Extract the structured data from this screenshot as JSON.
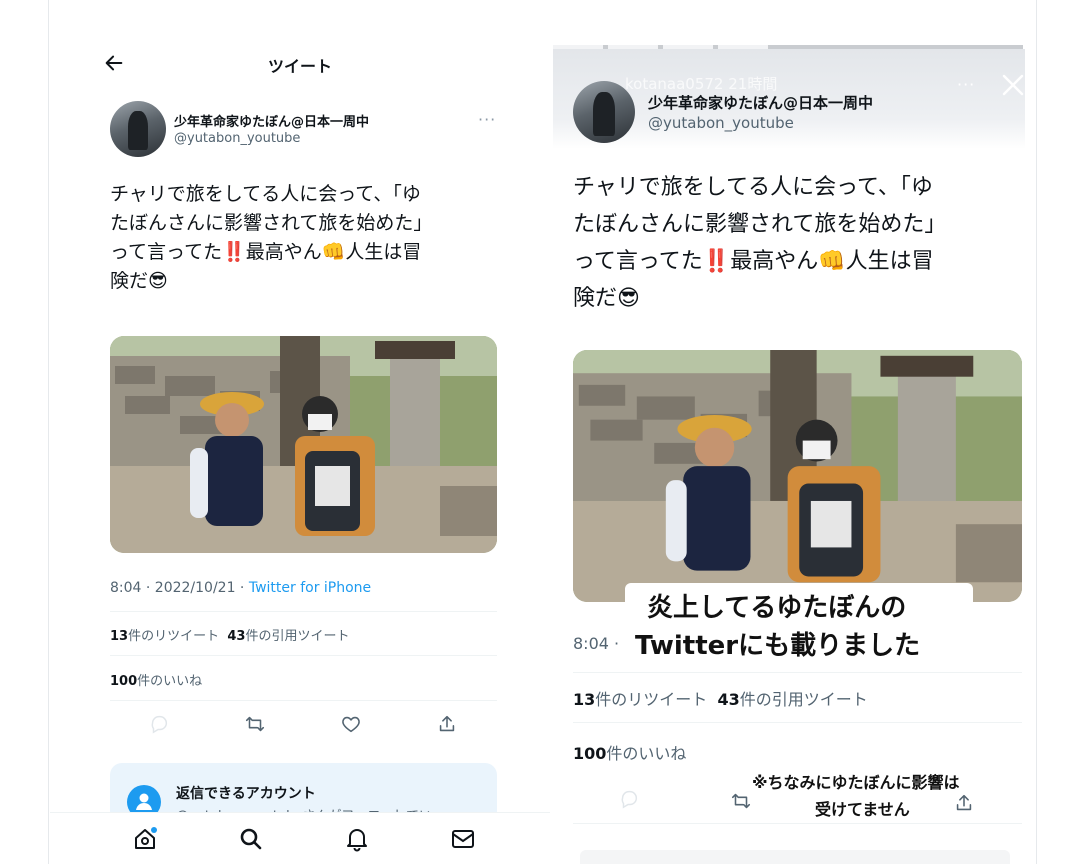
{
  "left": {
    "header": {
      "title": "ツイート"
    },
    "tweet": {
      "author_name": "少年革命家ゆたぼん@日本一周中",
      "author_handle": "@yutabon_youtube",
      "text_lines": [
        "チャリで旅をしてる人に会って、「ゆ",
        "たぼんさんに影響されて旅を始めた」",
        "って言ってた‼️最高やん👊人生は冒",
        "険だ😎"
      ],
      "timestamp": "8:04 · 2022/10/21 · ",
      "source": "Twitter for iPhone",
      "retweets_count": "13",
      "retweets_label": "件のリツイート",
      "quotes_count": "43",
      "quotes_label": "件の引用ツイート",
      "likes_count": "100",
      "likes_label": "件のいいね"
    },
    "reply_box": {
      "title": "返信できるアカウント",
      "subtitle": "@yutabon_youtubeさんがフォローしてい"
    },
    "nav": [
      "home-icon",
      "search-icon",
      "notifications-icon",
      "messages-icon"
    ],
    "actions": [
      "reply-icon",
      "retweet-icon",
      "like-icon",
      "share-icon"
    ]
  },
  "right": {
    "story_header": {
      "username": "kotanaa0572",
      "time": "21時間"
    },
    "tweet": {
      "author_name": "少年革命家ゆたぼん@日本一周中",
      "author_handle": "@yutabon_youtube",
      "text_lines": [
        "チャリで旅をしてる人に会って、「ゆ",
        "たぼんさんに影響されて旅を始めた」",
        "って言ってた‼️最高やん👊人生は冒",
        "険だ😎"
      ],
      "timestamp": "8:04 ·",
      "retweets_count": "13",
      "retweets_label": "件のリツイート",
      "quotes_count": "43",
      "quotes_label": "件の引用ツイート",
      "likes_count": "100",
      "likes_label": "件のいいね"
    },
    "caption": {
      "line1": "炎上してるゆたぼんの",
      "line2": "Twitterにも載りました"
    },
    "note": {
      "line1": "※ちなみにゆたぼんに影響は",
      "line2": "受けてません"
    }
  },
  "colors": {
    "accent": "#1d9bf0",
    "text": "#0f1419",
    "muted": "#536471",
    "divider": "#eff3f4"
  }
}
